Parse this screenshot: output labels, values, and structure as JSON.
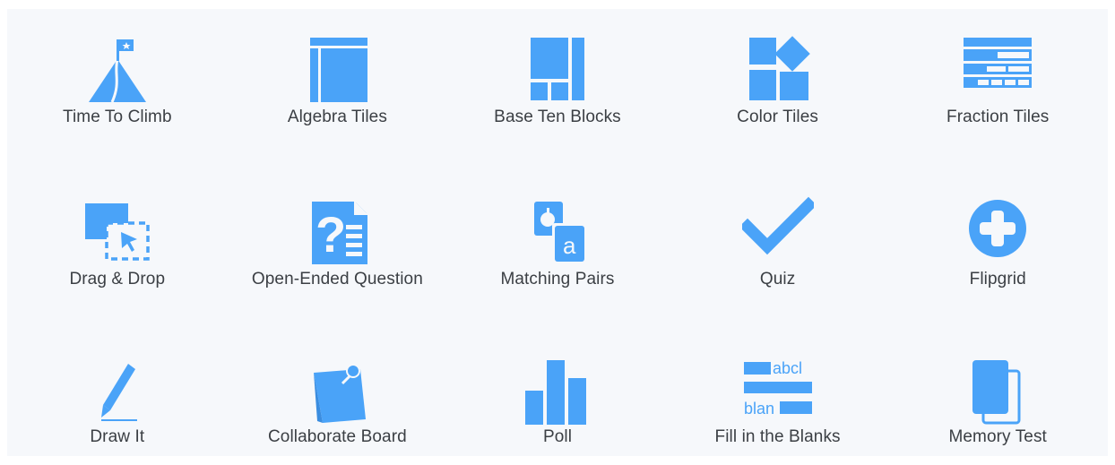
{
  "accent_color": "#4aa3f8",
  "tiles": [
    {
      "label": "Time To Climb",
      "icon": "mountain-flag-icon"
    },
    {
      "label": "Algebra Tiles",
      "icon": "algebra-tiles-icon"
    },
    {
      "label": "Base Ten Blocks",
      "icon": "base-ten-blocks-icon"
    },
    {
      "label": "Color Tiles",
      "icon": "color-tiles-icon"
    },
    {
      "label": "Fraction Tiles",
      "icon": "fraction-tiles-icon"
    },
    {
      "label": "Drag & Drop",
      "icon": "drag-drop-icon"
    },
    {
      "label": "Open-Ended Question",
      "icon": "question-document-icon"
    },
    {
      "label": "Matching Pairs",
      "icon": "matching-cards-icon"
    },
    {
      "label": "Quiz",
      "icon": "checkmark-icon"
    },
    {
      "label": "Flipgrid",
      "icon": "plus-circle-icon"
    },
    {
      "label": "Draw It",
      "icon": "pencil-icon"
    },
    {
      "label": "Collaborate Board",
      "icon": "pinned-note-icon"
    },
    {
      "label": "Poll",
      "icon": "bar-chart-icon"
    },
    {
      "label": "Fill in the Blanks",
      "icon": "fill-blanks-icon"
    },
    {
      "label": "Memory Test",
      "icon": "stacked-cards-icon"
    }
  ],
  "icon_text": {
    "matching_letter": "a",
    "fill_top_word": "abcl",
    "fill_bottom_word": "blan"
  }
}
